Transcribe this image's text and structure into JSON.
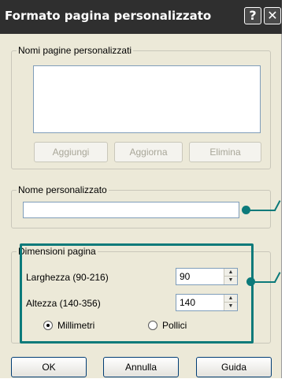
{
  "window": {
    "title": "Formato pagina personalizzato",
    "help_glyph": "?",
    "close_glyph": "✕"
  },
  "custom_names_group": {
    "legend": "Nomi pagine personalizzati",
    "items": [],
    "add_label": "Aggiungi",
    "update_label": "Aggiorna",
    "delete_label": "Elimina"
  },
  "custom_name_group": {
    "legend": "Nome personalizzato",
    "value": ""
  },
  "dimensions_group": {
    "legend": "Dimensioni pagina",
    "width_label": "Larghezza (90-216)",
    "width_value": "90",
    "height_label": "Altezza (140-356)",
    "height_value": "140",
    "unit_mm_label": "Millimetri",
    "unit_in_label": "Pollici",
    "selected_unit": "Millimetri"
  },
  "footer": {
    "ok_label": "OK",
    "cancel_label": "Annulla",
    "help_label": "Guida"
  },
  "colors": {
    "titlebar": "#2f2f2f",
    "callout": "#0c7a7a",
    "dialog_bg": "#ece9d8"
  }
}
